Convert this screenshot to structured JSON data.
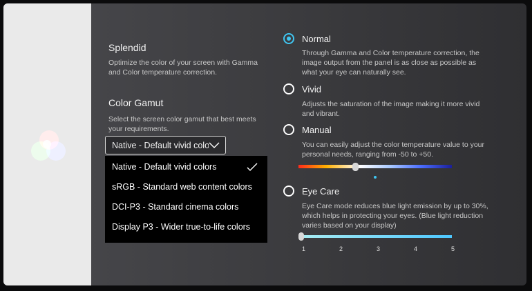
{
  "left": {
    "splendid_title": "Splendid",
    "splendid_desc_1": "Optimize the color of your screen with Gamma",
    "splendid_desc_2": "and Color temperature correction.",
    "gamut_title": "Color Gamut",
    "gamut_desc_1": "Select the screen color gamut that best meets",
    "gamut_desc_2": "your requirements.",
    "select_value": "Native - Default vivid colors",
    "menu_items": [
      {
        "label": "Native - Default vivid colors",
        "selected": true
      },
      {
        "label": "sRGB - Standard web content colors"
      },
      {
        "label": "DCI-P3 - Standard cinema colors"
      },
      {
        "label": "Display P3 - Wider true-to-life colors"
      }
    ]
  },
  "modes": {
    "selected": "Normal",
    "normal": {
      "label": "Normal",
      "desc_1": "Through Gamma and Color temperature correction, the",
      "desc_2": "image output from the panel is as close as possible as",
      "desc_3": "what your eye can naturally see."
    },
    "vivid": {
      "label": "Vivid",
      "desc_1": "Adjusts the saturation of the image making it more vivid",
      "desc_2": "and vibrant."
    },
    "manual": {
      "label": "Manual",
      "desc_1": "You can easily adjust the color temperature value to your",
      "desc_2": "personal needs, ranging from -50 to +50.",
      "slider_value_fraction": 0.37
    },
    "eye_care": {
      "label": "Eye Care",
      "desc_1": "Eye Care mode reduces blue light emission by up to 30%,",
      "desc_2": "which helps in protecting your eyes. (Blue light reduction",
      "desc_3": "varies based on your display)",
      "level": 1,
      "ticks": [
        "1",
        "2",
        "3",
        "4",
        "5"
      ]
    }
  },
  "colors": {
    "accent": "#3fc6f2"
  }
}
